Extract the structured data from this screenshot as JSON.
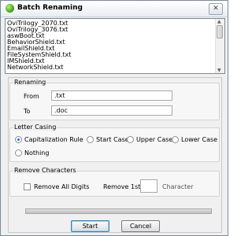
{
  "window": {
    "title": "Batch Renaming",
    "close_label": "✕"
  },
  "files": [
    "OviTrilogy_2070.txt",
    "OviTrilogy_3076.txt",
    "aswBoot.txt",
    "BehaviorShield.txt",
    "EmailShield.txt",
    "FileSystemShield.txt",
    "IMShield.txt",
    "NetworkShield.txt"
  ],
  "renaming": {
    "title": "Renaming",
    "from_label": "From",
    "from_value": ".txt",
    "to_label": "To",
    "to_value": ".doc"
  },
  "letter_casing": {
    "title": "Letter Casing",
    "options": [
      "Capitalization Rule",
      "Start Case",
      "Upper Case",
      "Lower Case",
      "Nothing"
    ],
    "selected": "Capitalization Rule"
  },
  "remove_characters": {
    "title": "Remove Characters",
    "remove_all_digits_label": "Remove All Digits",
    "remove_all_digits_checked": false,
    "remove_first_label": "Remove 1st",
    "remove_first_value": "",
    "character_label": "Character"
  },
  "progress": {
    "value": 0
  },
  "buttons": {
    "start": "Start",
    "cancel": "Cancel"
  }
}
